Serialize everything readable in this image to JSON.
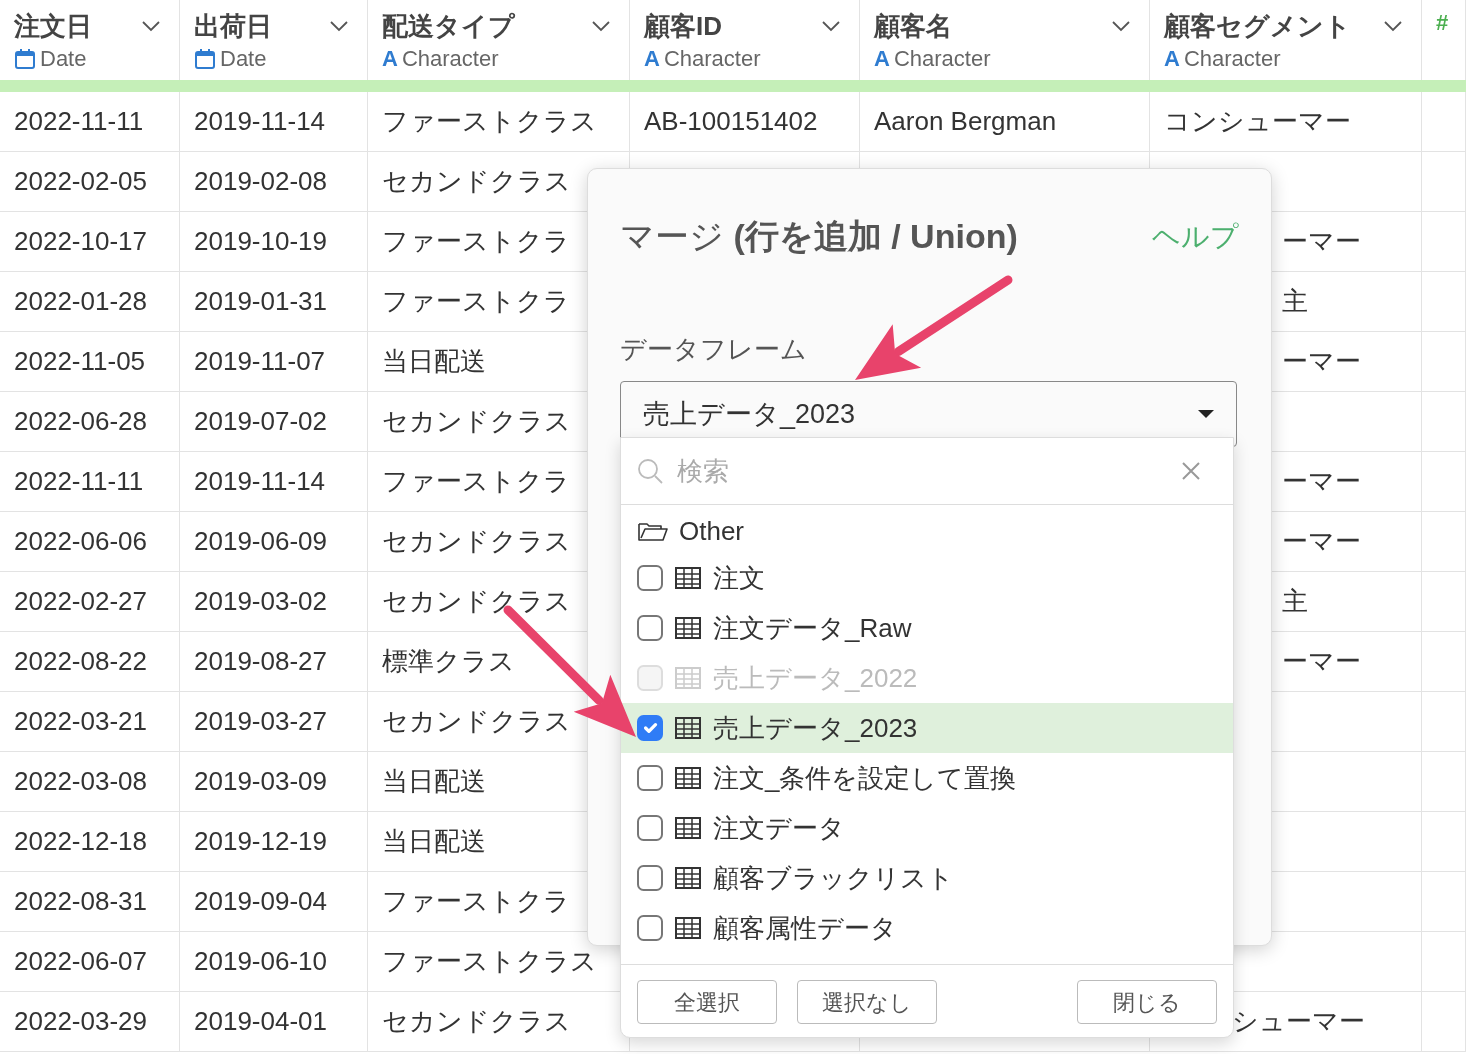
{
  "table": {
    "columns": [
      {
        "name": "注文日",
        "kind": "date",
        "type_label": "Date"
      },
      {
        "name": "出荷日",
        "kind": "date",
        "type_label": "Date"
      },
      {
        "name": "配送タイプ",
        "kind": "character",
        "type_symbol": "A",
        "type_label": "Character"
      },
      {
        "name": "顧客ID",
        "kind": "character",
        "type_symbol": "A",
        "type_label": "Character"
      },
      {
        "name": "顧客名",
        "kind": "character",
        "type_symbol": "A",
        "type_label": "Character"
      },
      {
        "name": "顧客セグメント",
        "kind": "character",
        "type_symbol": "A",
        "type_label": "Character"
      },
      {
        "kind": "number",
        "type_symbol": "#"
      }
    ],
    "rows": [
      {
        "kind": "none",
        "cells": [
          "2022-11-11",
          "2019-11-14",
          "ファーストクラス",
          "AB-100151402",
          "Aaron Bergman",
          "コンシューマー"
        ]
      },
      {
        "kind": "dialog",
        "cells": [
          "2022-02-05",
          "2019-02-08",
          "セカンドクラス",
          "",
          "",
          ""
        ]
      },
      {
        "kind": "dialog",
        "cells": [
          "2022-10-17",
          "2019-10-19",
          "ファーストクラ",
          "",
          "",
          "ーマー"
        ]
      },
      {
        "kind": "dialog",
        "cells": [
          "2022-01-28",
          "2019-01-31",
          "ファーストクラ",
          "",
          "",
          "主"
        ]
      },
      {
        "kind": "dialog",
        "cells": [
          "2022-11-05",
          "2019-11-07",
          "当日配送",
          "",
          "",
          "ーマー"
        ]
      },
      {
        "kind": "dialog",
        "cells": [
          "2022-06-28",
          "2019-07-02",
          "セカンドクラス",
          "",
          "",
          ""
        ]
      },
      {
        "kind": "dialog",
        "cells": [
          "2022-11-11",
          "2019-11-14",
          "ファーストクラ",
          "",
          "",
          "ーマー"
        ]
      },
      {
        "kind": "dialog",
        "cells": [
          "2022-06-06",
          "2019-06-09",
          "セカンドクラス",
          "",
          "",
          "ーマー"
        ]
      },
      {
        "kind": "dialog",
        "cells": [
          "2022-02-27",
          "2019-03-02",
          "セカンドクラス",
          "",
          "",
          "主"
        ]
      },
      {
        "kind": "dialog",
        "cells": [
          "2022-08-22",
          "2019-08-27",
          "標準クラス",
          "",
          "",
          "ーマー"
        ]
      },
      {
        "kind": "dialog",
        "cells": [
          "2022-03-21",
          "2019-03-27",
          "セカンドクラス",
          "",
          "",
          ""
        ]
      },
      {
        "kind": "dialog",
        "cells": [
          "2022-03-08",
          "2019-03-09",
          "当日配送",
          "",
          "",
          ""
        ]
      },
      {
        "kind": "dialog",
        "cells": [
          "2022-12-18",
          "2019-12-19",
          "当日配送",
          "",
          "",
          ""
        ]
      },
      {
        "kind": "dialog",
        "cells": [
          "2022-08-31",
          "2019-09-04",
          "ファーストクラ",
          "",
          "",
          ""
        ]
      },
      {
        "kind": "dialog",
        "cells": [
          "2022-06-07",
          "2019-06-10",
          "ファーストクラス",
          "",
          "",
          ""
        ]
      },
      {
        "kind": "dropdown",
        "cells": [
          "2022-03-29",
          "2019-04-01",
          "セカンドクラス",
          "",
          "",
          "シューマー"
        ]
      }
    ]
  },
  "dialog": {
    "title": "マージ **(行を追加 / Union)**",
    "help_link": "ヘルプ",
    "field_label": "データフレーム",
    "select_value": "売上データ_2023",
    "dropdown": {
      "search_placeholder": "検索",
      "group": "Other",
      "items": [
        {
          "label": "注文",
          "checked": false,
          "disabled": false,
          "selected": false
        },
        {
          "label": "注文データ_Raw",
          "checked": false,
          "disabled": false,
          "selected": false
        },
        {
          "label": "売上データ_2022",
          "checked": false,
          "disabled": true,
          "selected": false
        },
        {
          "label": "売上データ_2023",
          "checked": true,
          "disabled": false,
          "selected": true
        },
        {
          "label": "注文_条件を設定して置換",
          "checked": false,
          "disabled": false,
          "selected": false
        },
        {
          "label": "注文データ",
          "checked": false,
          "disabled": false,
          "selected": false
        },
        {
          "label": "顧客ブラックリスト",
          "checked": false,
          "disabled": false,
          "selected": false
        },
        {
          "label": "顧客属性データ",
          "checked": false,
          "disabled": false,
          "selected": false
        }
      ],
      "buttons": [
        "全選択",
        "選択なし",
        "閉じる"
      ]
    }
  }
}
